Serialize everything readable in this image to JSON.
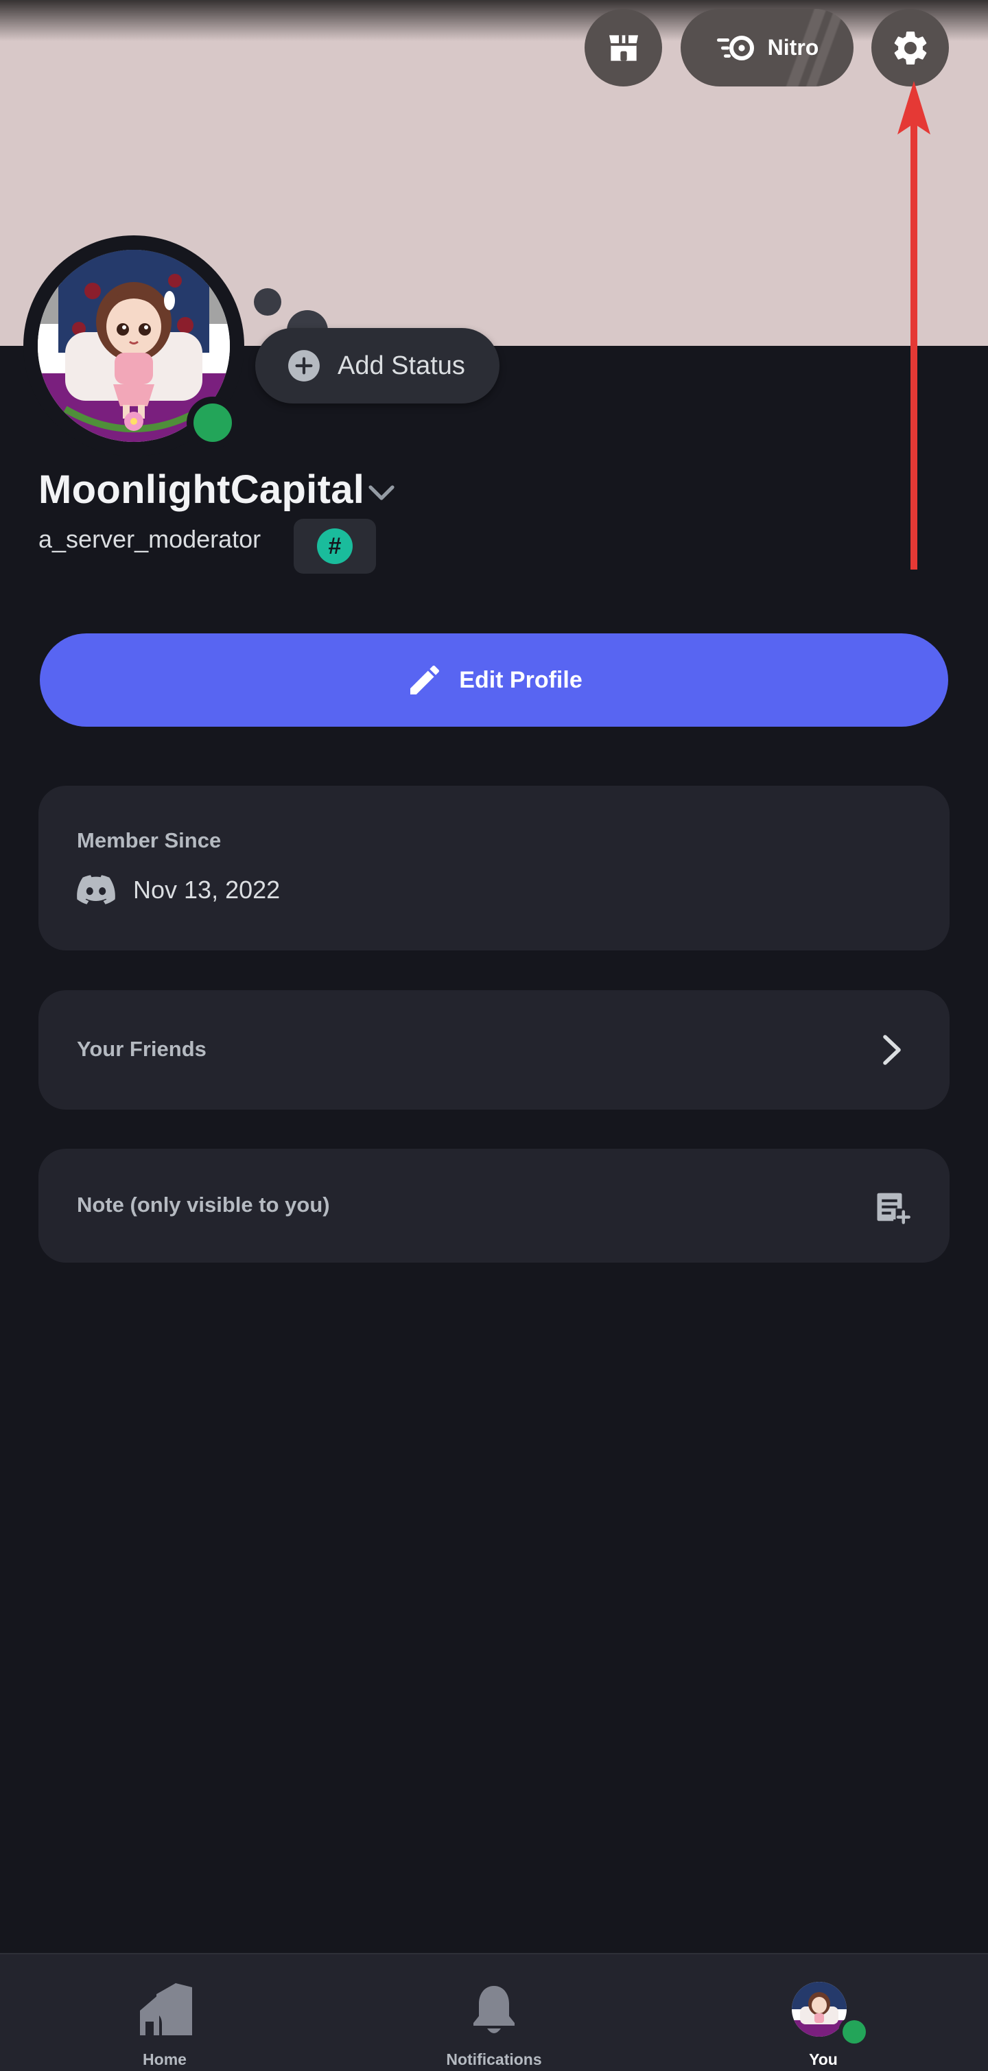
{
  "header": {
    "shop_icon": "shop-icon",
    "nitro_label": "Nitro",
    "nitro_icon": "nitro-icon",
    "settings_icon": "gear-icon"
  },
  "colors": {
    "banner": "#d8c8c8",
    "background": "#15161d",
    "card": "#23242d",
    "accent": "#5865f2",
    "online": "#23a559",
    "annotation": "#e53935"
  },
  "profile": {
    "display_name": "MoonlightCapital",
    "username": "a_server_moderator",
    "tag_badge": "#",
    "add_status_label": "Add Status",
    "edit_profile_label": "Edit Profile"
  },
  "member_since": {
    "heading": "Member Since",
    "date": "Nov 13, 2022"
  },
  "friends": {
    "label": "Your Friends"
  },
  "note": {
    "label": "Note (only visible to you)"
  },
  "nav": {
    "home": "Home",
    "notifications": "Notifications",
    "you": "You"
  }
}
